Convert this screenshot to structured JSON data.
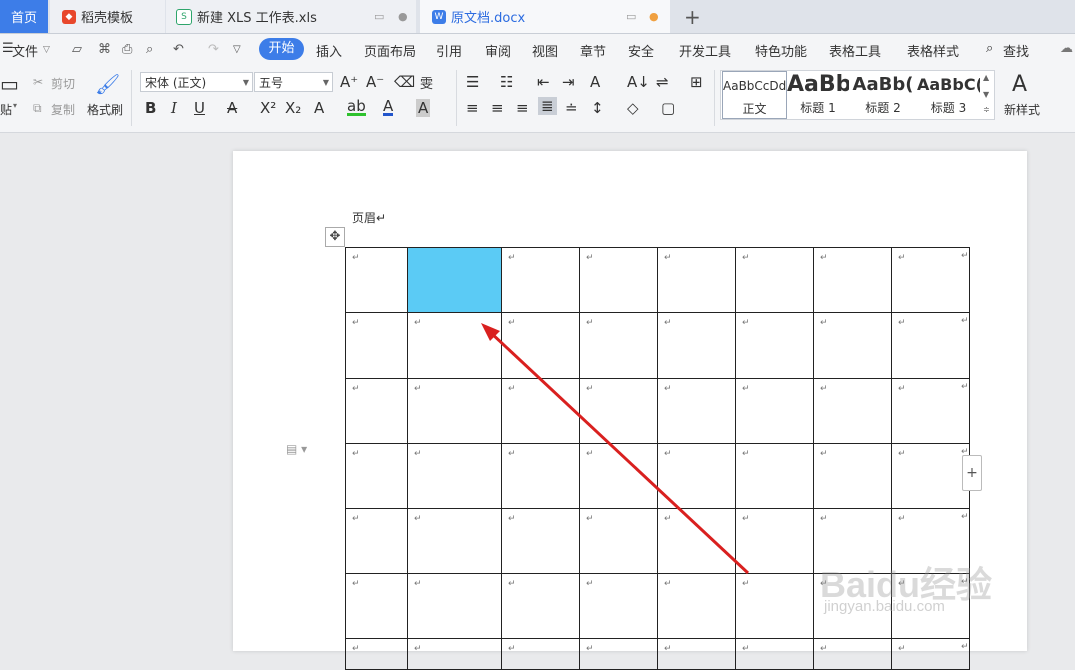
{
  "tabs": {
    "home": "首页",
    "daoke": "稻壳模板",
    "xls": "新建 XLS 工作表.xls",
    "doc": "原文档.docx",
    "new_tab": "+"
  },
  "menu": {
    "file": "文件",
    "items": [
      "开始",
      "插入",
      "页面布局",
      "引用",
      "审阅",
      "视图",
      "章节",
      "安全",
      "开发工具",
      "特色功能",
      "表格工具",
      "表格样式"
    ],
    "search": "查找"
  },
  "ribbon": {
    "paste": "贴",
    "cut": "剪切",
    "copy": "复制",
    "format_painter": "格式刷",
    "font_name": "宋体 (正文)",
    "font_size": "五号",
    "styles": [
      {
        "sample": "AaBbCcDd",
        "name": "正文"
      },
      {
        "sample": "AaBb",
        "name": "标题 1"
      },
      {
        "sample": "AaBb(",
        "name": "标题 2"
      },
      {
        "sample": "AaBbC(",
        "name": "标题 3"
      }
    ],
    "new_style": "新样式"
  },
  "document": {
    "header": "页眉↵",
    "para_mark": "↵",
    "rows": 7,
    "cols": 8,
    "selected_cell": [
      0,
      1
    ]
  },
  "watermark": {
    "logo": "Baidu经验",
    "url": "jingyan.baidu.com"
  },
  "colors": {
    "accent": "#3d7de8",
    "selected_cell": "#5bcbf5",
    "arrow": "#d9201f"
  }
}
